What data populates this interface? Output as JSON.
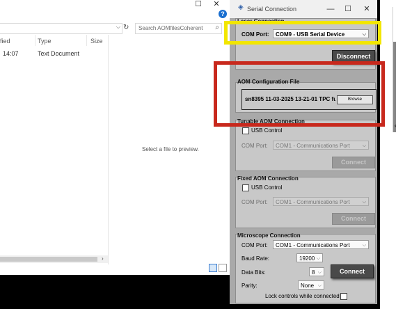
{
  "explorer": {
    "search_placeholder": "Search AOMfilesCoherent",
    "columns": {
      "modified": "fied",
      "type": "Type",
      "size": "Size"
    },
    "row": {
      "modified": "14:07",
      "type": "Text Document"
    },
    "preview_text": "Select a file to preview."
  },
  "serial": {
    "title": "Serial Connection",
    "laser": {
      "title": "Laser Connection",
      "com_port_label": "COM Port:",
      "com_port_value": "COM9 - USB Serial Device",
      "disconnect_label": "Disconnect"
    },
    "aom_config": {
      "title": "AOM Configuration File",
      "file_value": "sn8395 11-03-2025 13-21-01 TPC fu",
      "browse_label": "Browse"
    },
    "tunable": {
      "title": "Tunable AOM Connection",
      "usb_label": "USB Control",
      "com_port_label": "COM Port:",
      "com_port_value": "COM1 - Communications Port",
      "connect_label": "Connect"
    },
    "fixed": {
      "title": "Fixed AOM Connection",
      "usb_label": "USB Control",
      "com_port_label": "COM Port:",
      "com_port_value": "COM1 - Communications Port",
      "connect_label": "Connect"
    },
    "microscope": {
      "title": "Microscope Connection",
      "com_port_label": "COM Port:",
      "com_port_value": "COM1 - Communications Port",
      "baud_label": "Baud Rate:",
      "baud_value": "19200",
      "databits_label": "Data Bits:",
      "databits_value": "8",
      "parity_label": "Parity:",
      "parity_value": "None",
      "connect_label": "Connect",
      "lock_label": "Lock controls while connected"
    }
  },
  "highlights": {
    "yellow": "#f2e600",
    "red": "#c8281c"
  },
  "icons": [
    "minimize-icon",
    "maximize-icon",
    "close-icon",
    "help-icon",
    "refresh-icon",
    "search-icon",
    "chevron-down-icon",
    "serial-app-icon",
    "scroll-right-icon",
    "details-view-icon"
  ]
}
